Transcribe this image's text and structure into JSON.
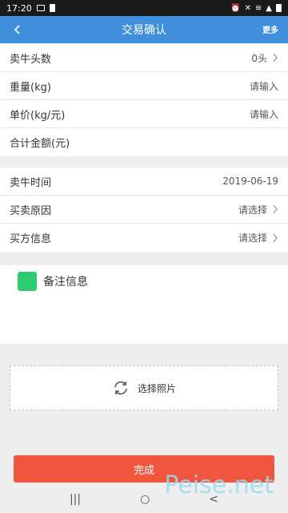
{
  "status_bar": {
    "time": "17:20"
  },
  "nav": {
    "title": "交易确认",
    "more": "更多"
  },
  "groups": [
    [
      {
        "label": "卖牛头数",
        "value": "0头",
        "chevron": true
      },
      {
        "label": "重量(kg)",
        "value": "请输入",
        "chevron": false
      },
      {
        "label": "单价(kg/元)",
        "value": "请输入",
        "chevron": false
      },
      {
        "label": "合计金额(元)",
        "value": "",
        "chevron": false
      }
    ],
    [
      {
        "label": "卖牛时间",
        "value": "2019-06-19",
        "chevron": false
      },
      {
        "label": "买卖原因",
        "value": "请选择",
        "chevron": true
      },
      {
        "label": "买方信息",
        "value": "请选择",
        "chevron": true
      }
    ]
  ],
  "note": {
    "label": "备注信息",
    "icon": "note-icon",
    "icon_color": "#2ecc71"
  },
  "photo": {
    "label": "选择照片",
    "icon": "refresh-icon"
  },
  "done_button": {
    "label": "完成",
    "color": "#f0553e"
  },
  "system_nav": {
    "recents": "|||",
    "home": "○",
    "back": "<"
  },
  "watermark": "Peise.net",
  "colors": {
    "nav": "#3f8fdc",
    "accent": "#2ecc71"
  }
}
